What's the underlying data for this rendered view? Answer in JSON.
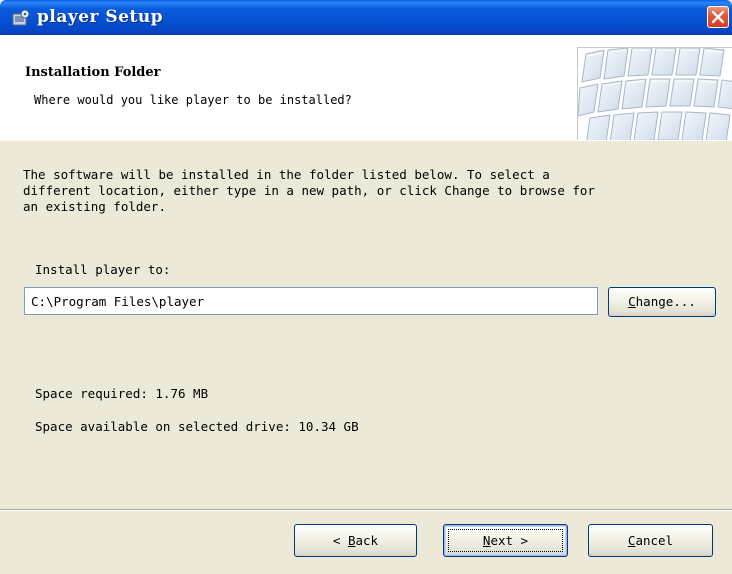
{
  "window": {
    "title": "player Setup",
    "icon": "setup-icon",
    "close_icon": "close-icon"
  },
  "header": {
    "title": "Installation Folder",
    "subtitle": "Where would you like player to be installed?",
    "graphic": "keyboard-keys-graphic"
  },
  "body": {
    "description": "The software will be installed in the folder listed below. To select a\ndifferent location, either type in a new path, or click Change to browse for\nan existing folder.",
    "install_label": "Install player to:",
    "install_path": "C:\\Program Files\\player",
    "change_button": {
      "mnemonic": "C",
      "rest": "hange..."
    },
    "space_required": "Space required: 1.76 MB",
    "space_available": "Space available on selected drive: 10.34 GB"
  },
  "footer": {
    "back_button": {
      "prefix": "< ",
      "mnemonic": "B",
      "rest": "ack"
    },
    "next_button": {
      "mnemonic": "N",
      "rest": "ext >"
    },
    "cancel_button": {
      "mnemonic": "C",
      "rest": "ancel"
    }
  },
  "colors": {
    "titlebar": "#0650D2",
    "dialog_background": "#ECE9D8",
    "button_border": "#003C74",
    "close_button": "#D23F1F"
  }
}
